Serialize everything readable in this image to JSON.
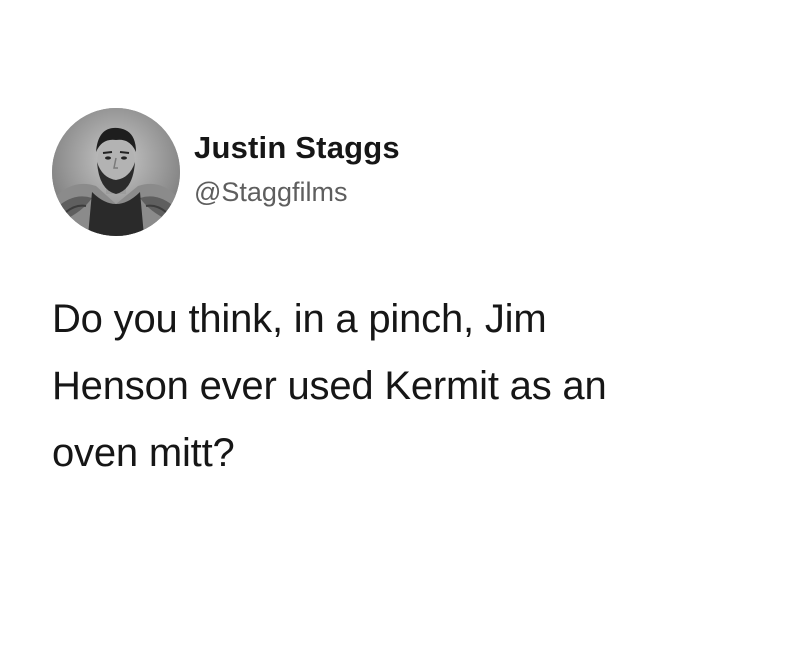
{
  "tweet": {
    "avatar_icon": "profile-photo-avatar",
    "display_name": "Justin Staggs",
    "handle": "@Staggfilms",
    "text_lines": [
      "Do you think, in a pinch, Jim",
      "Henson ever used Kermit as an",
      "oven mitt?"
    ]
  },
  "colors": {
    "background": "#ffffff",
    "name_text": "#161616",
    "handle_text": "#5e5e5e",
    "body_text": "#161616"
  }
}
